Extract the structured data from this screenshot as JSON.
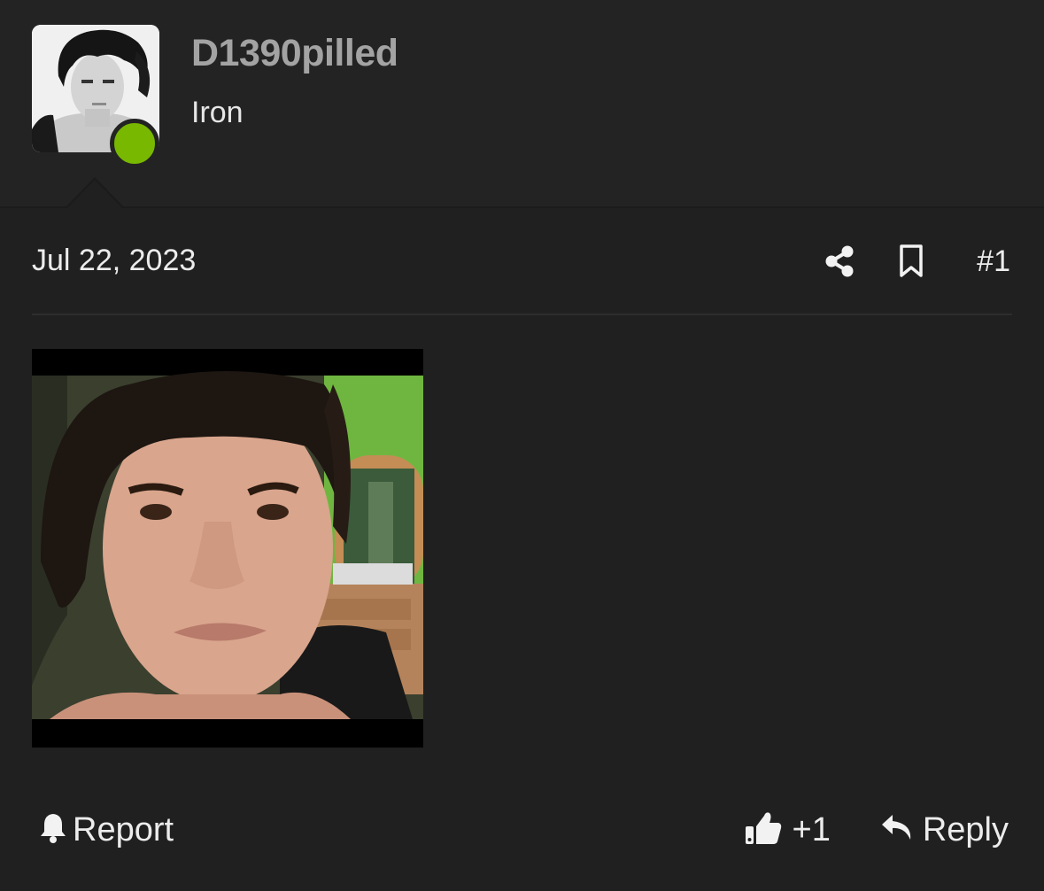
{
  "author": {
    "username": "D1390pilled",
    "user_title": "Iron",
    "avatar_icon": "avatar-photo",
    "status": "online",
    "status_color": "#78b800"
  },
  "post": {
    "date": "Jul 22, 2023",
    "number": "#1",
    "share_icon": "share-icon",
    "bookmark_icon": "bookmark-icon",
    "attachment_icon": "selfie-photo"
  },
  "footer": {
    "report_label": "Report",
    "report_icon": "bell-icon",
    "like_icon": "thumbs-up-icon",
    "like_label": "+1",
    "reply_label": "Reply",
    "reply_icon": "reply-arrow-icon"
  },
  "colors": {
    "background": "#202020",
    "header_background": "#232323",
    "username": "#a3a3a3",
    "text": "#ececec"
  }
}
